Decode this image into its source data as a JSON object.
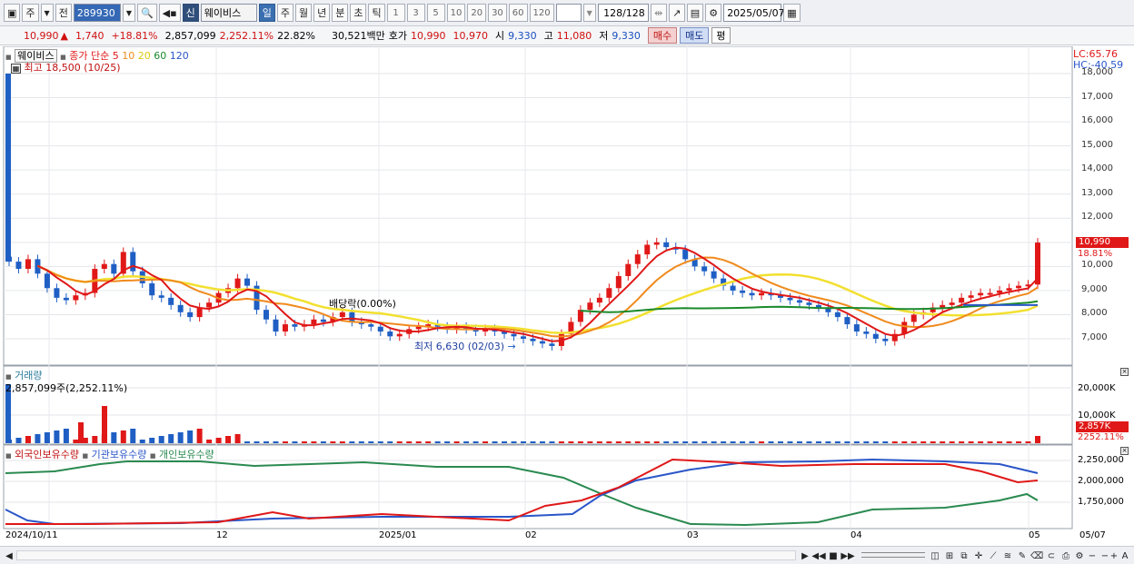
{
  "toolbar": {
    "market": "주",
    "prev": "전",
    "code": "289930",
    "badge": "신",
    "name": "웨이비스",
    "periods": [
      "일",
      "주",
      "월",
      "년",
      "분",
      "초",
      "틱"
    ],
    "intervals": [
      "1",
      "3",
      "5",
      "10",
      "20",
      "30",
      "60",
      "120"
    ],
    "count": "128/128",
    "date": "2025/05/07"
  },
  "info": {
    "price": "10,990",
    "change_arrow": "▲",
    "change": "1,740",
    "change_pct": "+18.81%",
    "volume": "2,857,099",
    "vol_ratio": "2,252.11%",
    "turnover": "22.82%",
    "amount": "30,521백만",
    "quote_label": "호가",
    "ask": "10,990",
    "bid": "10,970",
    "open_label": "시",
    "open": "9,330",
    "high_label": "고",
    "high": "11,080",
    "low_label": "저",
    "low": "9,330",
    "buy": "매수",
    "sell": "매도",
    "avg": "평"
  },
  "legend": {
    "name": "웨이비스",
    "ma_label": "종가 단순",
    "ma5": "5",
    "ma10": "10",
    "ma20": "20",
    "ma60": "60",
    "ma120": "120",
    "high_note": "최고 18,500 (10/25)",
    "low_note": "최저 6,630 (02/03)",
    "dividend_note": "배당락(0.00%)",
    "lc": "LC:65.76",
    "hc": "HC:-40.59",
    "volume_title": "거래량",
    "volume_value": "2,857,099주(2,252.11%)",
    "flow_foreign": "외국인보유수량",
    "flow_inst": "기관보유수량",
    "flow_indiv": "개인보유수량"
  },
  "axis": {
    "price_ticks": [
      "18,000",
      "17,000",
      "16,000",
      "15,000",
      "14,000",
      "13,000",
      "12,000",
      "11,000",
      "10,000",
      "9,000",
      "8,000",
      "7,000"
    ],
    "current_price_tag": "10,990",
    "current_pct_tag": "18.81%",
    "volume_ticks": [
      "20,000K",
      "10,000K"
    ],
    "volume_tag": "2,857K",
    "volume_pct_tag": "2252.11%",
    "flow_ticks": [
      "2,250,000",
      "2,000,000",
      "1,750,000"
    ],
    "x_labels": [
      "2024/10/11",
      "12",
      "2025/01",
      "02",
      "03",
      "04",
      "05",
      "05/07"
    ]
  },
  "colors": {
    "up": "#e01818",
    "down": "#1f5fc4",
    "ma5": "#e01818",
    "ma10": "#f08a1c",
    "ma20": "#f2e030",
    "ma60": "#1a8a2a",
    "ma120": "#2a56c8",
    "foreign": "#e01818",
    "inst": "#2a56c8",
    "indiv": "#2a8a50"
  }
}
